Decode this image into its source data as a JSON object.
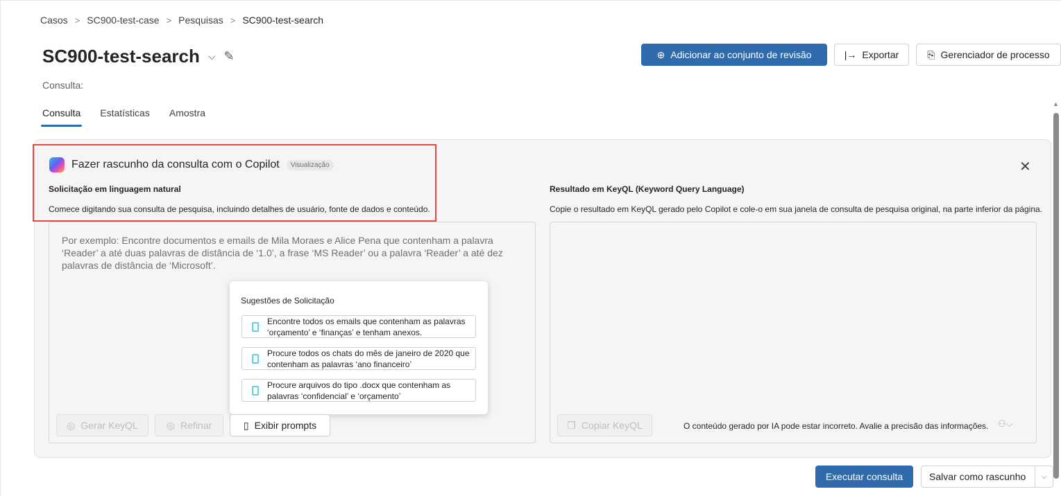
{
  "breadcrumb": [
    "Casos",
    "SC900-test-case",
    "Pesquisas",
    "SC900-test-search"
  ],
  "title": "SC900-test-search",
  "actions": {
    "add": "Adicionar ao conjunto de revisão",
    "export": "Exportar",
    "process": "Gerenciador de processo"
  },
  "query_label": "Consulta:",
  "tabs": [
    "Consulta",
    "Estatísticas",
    "Amostra"
  ],
  "copilot": {
    "title": "Fazer rascunho da consulta com o Copilot",
    "badge": "Visualização",
    "left_heading": "Solicitação em linguagem natural",
    "left_desc": "Comece digitando sua consulta de pesquisa, incluindo detalhes de usuário, fonte de dados e conteúdo.",
    "placeholder": "Por exemplo: Encontre documentos e emails de Mila Moraes e Alice Pena que contenham a palavra ‘Reader’ a até duas palavras de distância de ‘1.0’, a frase ‘MS Reader’ ou a palavra ‘Reader’ a até dez palavras de distância de ‘Microsoft’.",
    "right_heading": "Resultado em KeyQL (Keyword Query Language)",
    "right_desc": "Copie o resultado em KeyQL gerado pelo Copilot e cole-o em sua janela de consulta de pesquisa original, na parte inferior da página.",
    "suggestions_title": "Sugestões de Solicitação",
    "suggestions": [
      "Encontre todos os emails que contenham as palavras ‘orçamento’ e ‘finanças’ e tenham anexos.",
      "Procure todos os chats do mês de janeiro de 2020 que contenham as palavras ‘ano financeiro’",
      "Procure arquivos do tipo .docx que contenham as palavras ‘confidencial’ e ‘orçamento’"
    ],
    "generate": "Gerar KeyQL",
    "refine": "Refinar",
    "show_prompts": "Exibir prompts",
    "copy": "Copiar KeyQL",
    "disclaimer": "O conteúdo gerado por IA pode estar incorreto. Avalie a precisão das informações."
  },
  "footer": {
    "run": "Executar consulta",
    "save": "Salvar como rascunho"
  }
}
